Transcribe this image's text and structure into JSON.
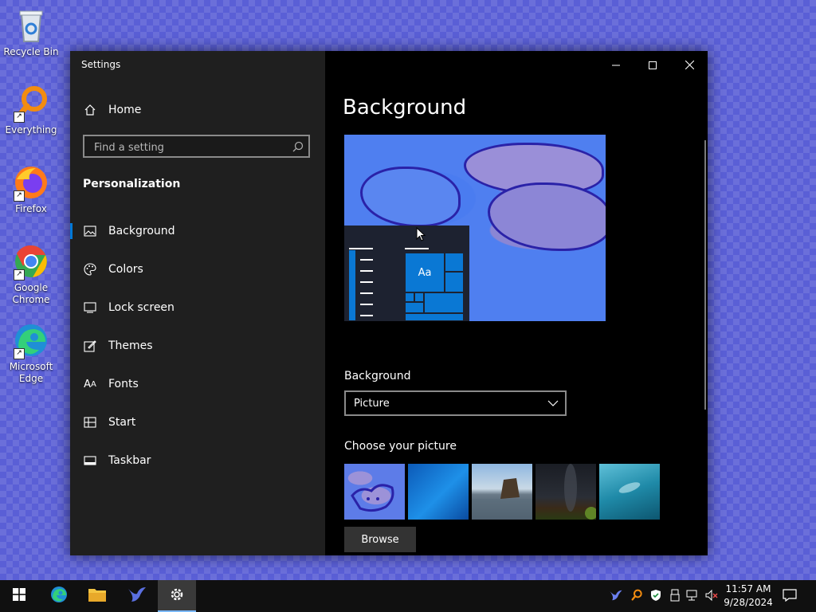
{
  "desktop": {
    "icons": [
      {
        "label": "Recycle Bin"
      },
      {
        "label": "Everything"
      },
      {
        "label": "Firefox"
      },
      {
        "label": "Google Chrome"
      },
      {
        "label": "Microsoft Edge"
      }
    ]
  },
  "window": {
    "app_title": "Settings",
    "home_label": "Home",
    "search_placeholder": "Find a setting",
    "section_title": "Personalization",
    "nav": [
      {
        "label": "Background",
        "icon": "picture-icon",
        "active": true
      },
      {
        "label": "Colors",
        "icon": "palette-icon"
      },
      {
        "label": "Lock screen",
        "icon": "lock-screen-icon"
      },
      {
        "label": "Themes",
        "icon": "themes-icon"
      },
      {
        "label": "Fonts",
        "icon": "fonts-icon"
      },
      {
        "label": "Start",
        "icon": "start-icon"
      },
      {
        "label": "Taskbar",
        "icon": "taskbar-icon"
      }
    ]
  },
  "content": {
    "page_title": "Background",
    "preview": {
      "tile_label": "Aa"
    },
    "background_label": "Background",
    "background_value": "Picture",
    "choose_label": "Choose your picture",
    "browse_label": "Browse"
  },
  "taskbar": {
    "time": "11:57 AM",
    "date": "9/28/2024"
  },
  "colors": {
    "accent": "#0078d7",
    "tile": "#0a78d4"
  }
}
